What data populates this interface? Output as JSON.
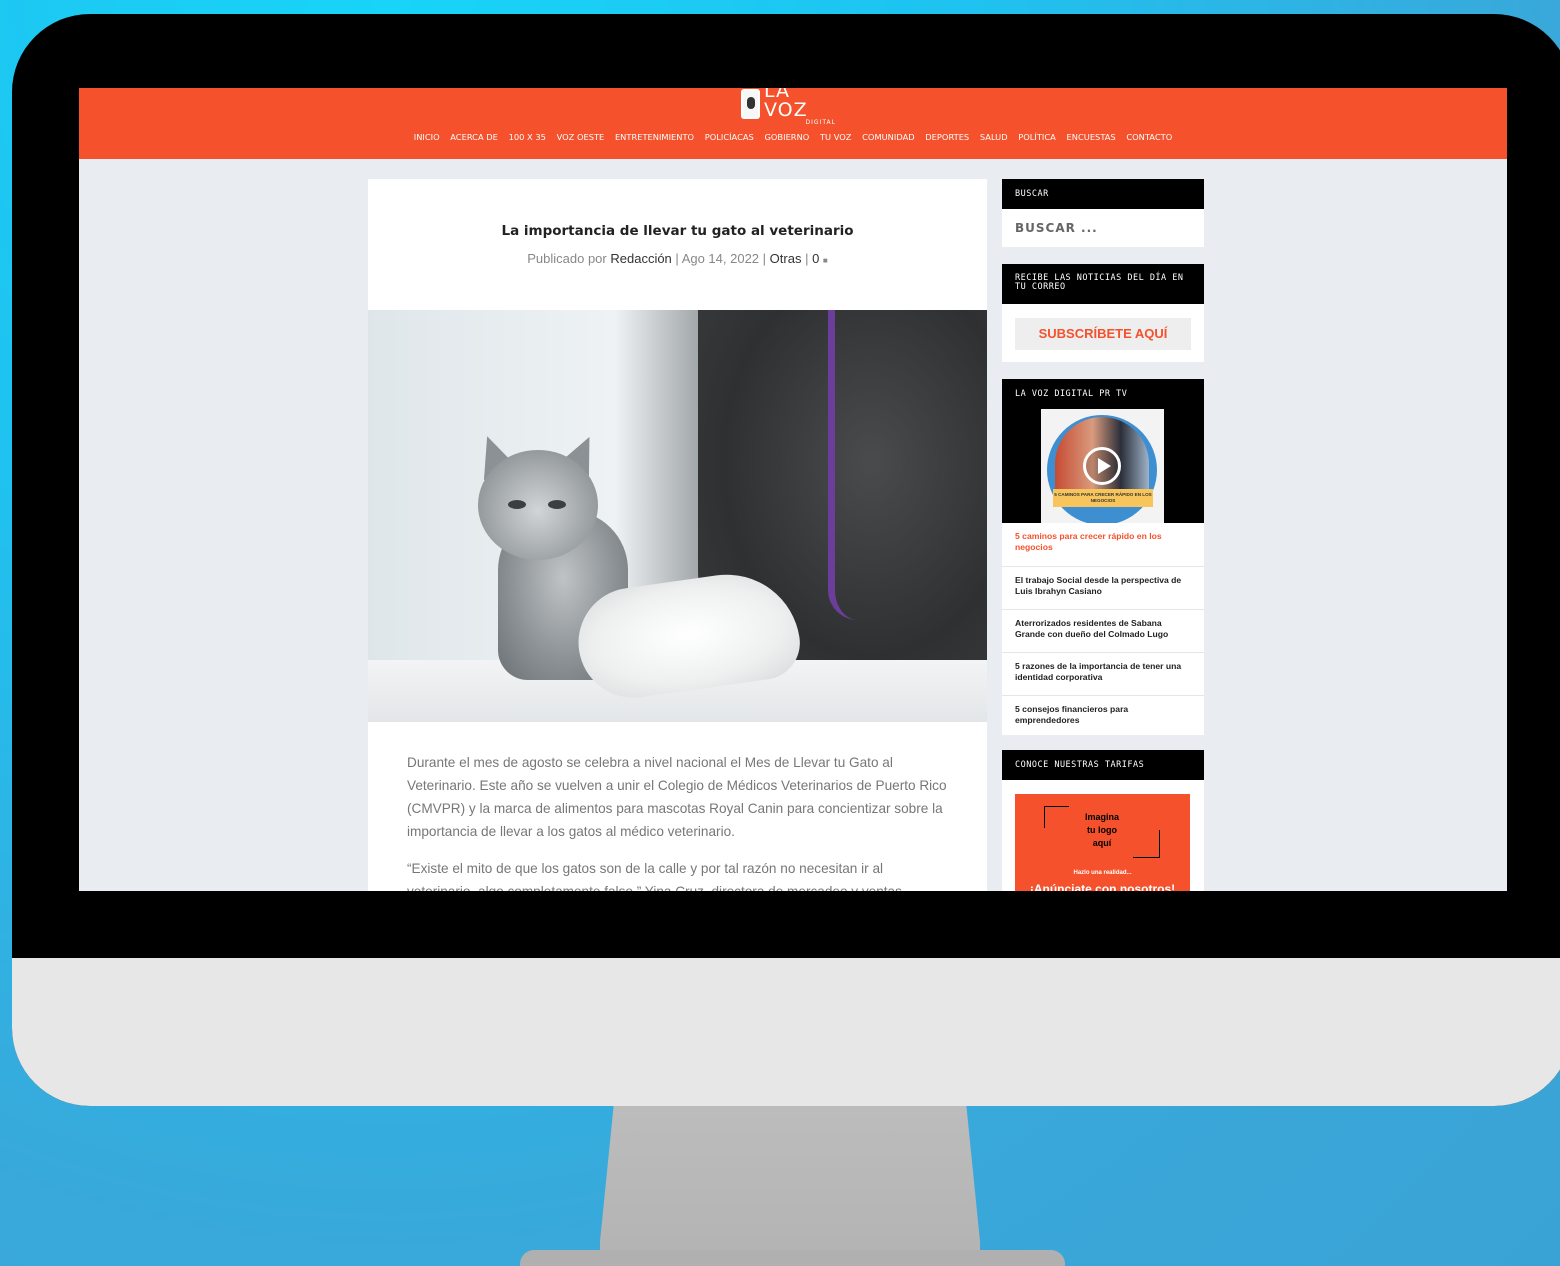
{
  "site": {
    "logo_text": "LA VOZ",
    "logo_sub": "DIGITAL",
    "nav": [
      "INICIO",
      "ACERCA DE",
      "100 X 35",
      "VOZ OESTE",
      "ENTRETENIMIENTO",
      "POLICÍACAS",
      "GOBIERNO",
      "TU VOZ",
      "COMUNIDAD",
      "DEPORTES",
      "SALUD",
      "POLÍTICA",
      "ENCUESTAS",
      "CONTACTO"
    ],
    "colors": {
      "brand": "#f4512c",
      "background": "#e9ecf1"
    }
  },
  "post": {
    "title": "La importancia de llevar tu gato al veterinario",
    "meta_prefix": "Publicado por",
    "author": "Redacción",
    "date": "Ago 14, 2022",
    "category": "Otras",
    "comments": "0",
    "paragraphs": [
      "Durante el mes de agosto se celebra a nivel nacional el Mes de Llevar tu Gato al Veterinario.  Este año se vuelven a unir el Colegio de Médicos Veterinarios de Puerto Rico (CMVPR) y la marca de alimentos para mascotas Royal Canin para concientizar sobre la importancia de llevar a los gatos al médico veterinario.",
      "“Existe el mito de que los gatos son de la calle y por tal razón no necesitan ir al veterinario, algo completamente falso,” Yina Cruz, directora de mercadeo y ventas"
    ]
  },
  "sidebar": {
    "search": {
      "title": "BUSCAR",
      "placeholder": "BUSCAR ..."
    },
    "newsletter": {
      "title": "RECIBE LAS NOTICIAS DEL DÍA EN TU CORREO",
      "button": "SUBSCRÍBETE AQUÍ"
    },
    "tv": {
      "title": "LA VOZ DIGITAL PR TV",
      "video_banner": "5 CAMINOS PARA CRECER RÁPIDO EN LOS NEGOCIOS",
      "items": [
        "5 caminos para crecer rápido en los negocios",
        "El trabajo Social desde la perspectiva de Luis Ibrahyn Casiano",
        "Aterrorizados residentes de Sabana Grande con dueño del Colmado Lugo",
        "5 razones de la importancia de tener una identidad corporativa",
        "5 consejos financieros para emprendedores"
      ]
    },
    "rates": {
      "title": "CONOCE NUESTRAS TARIFAS",
      "ad_line1": "Imagina",
      "ad_line2": "tu logo",
      "ad_line3": "aquí",
      "ad_sub": "Hazlo una realidad...",
      "ad_cta": "¡Anúnciate con nosotros!"
    }
  }
}
